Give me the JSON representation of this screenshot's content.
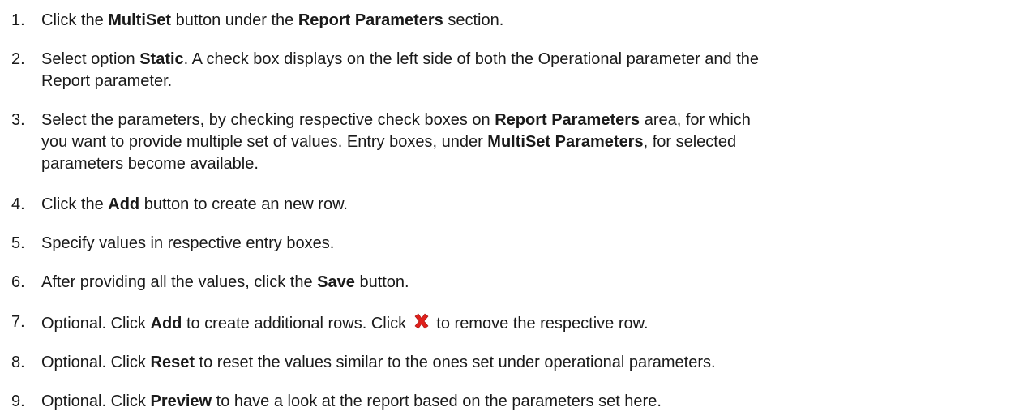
{
  "steps": [
    {
      "number": "1.",
      "lines": [
        [
          {
            "t": "Click the "
          },
          {
            "t": "MultiSet",
            "b": true
          },
          {
            "t": " button under the "
          },
          {
            "t": "Report Parameters",
            "b": true
          },
          {
            "t": " section."
          }
        ]
      ]
    },
    {
      "number": "2.",
      "lines": [
        [
          {
            "t": "Select option "
          },
          {
            "t": "Static",
            "b": true
          },
          {
            "t": ". A check box displays on the left side of both the Operational parameter and the"
          }
        ],
        [
          {
            "t": "Report parameter."
          }
        ]
      ]
    },
    {
      "number": "3.",
      "lines": [
        [
          {
            "t": "Select the parameters, by checking respective check boxes on "
          },
          {
            "t": "Report Parameters",
            "b": true
          },
          {
            "t": " area, for which"
          }
        ],
        [
          {
            "t": "you want to provide multiple set of values. Entry boxes, under "
          },
          {
            "t": "MultiSet Parameters",
            "b": true
          },
          {
            "t": ", for selected"
          }
        ],
        [
          {
            "t": "parameters become available."
          }
        ]
      ]
    },
    {
      "number": "4.",
      "lines": [
        [
          {
            "t": "Click the "
          },
          {
            "t": "Add",
            "b": true
          },
          {
            "t": " button to create an new row."
          }
        ]
      ]
    },
    {
      "number": "5.",
      "lines": [
        [
          {
            "t": "Specify values in respective entry boxes."
          }
        ]
      ]
    },
    {
      "number": "6.",
      "lines": [
        [
          {
            "t": "After providing all the values, click the "
          },
          {
            "t": "Save",
            "b": true
          },
          {
            "t": " button."
          }
        ]
      ]
    },
    {
      "number": "7.",
      "lines": [
        [
          {
            "t": "Optional. Click "
          },
          {
            "t": "Add",
            "b": true
          },
          {
            "t": " to create additional rows. Click "
          },
          {
            "icon": "remove-x-icon"
          },
          {
            "t": " to remove the respective row."
          }
        ]
      ]
    },
    {
      "number": "8.",
      "lines": [
        [
          {
            "t": "Optional. Click "
          },
          {
            "t": "Reset",
            "b": true
          },
          {
            "t": " to reset the values similar to the ones set under operational parameters."
          }
        ]
      ]
    },
    {
      "number": "9.",
      "lines": [
        [
          {
            "t": "Optional. Click "
          },
          {
            "t": "Preview",
            "b": true
          },
          {
            "t": " to have a look at the report based on the parameters set here."
          }
        ]
      ]
    }
  ],
  "colors": {
    "text": "#1a1a1a",
    "remove_icon": "#e0201b"
  }
}
